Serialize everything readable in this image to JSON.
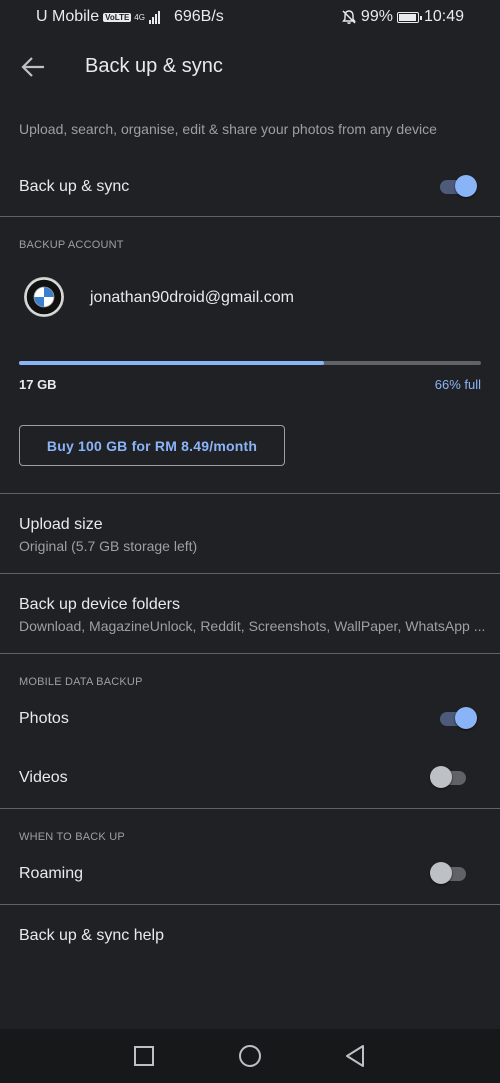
{
  "status_bar": {
    "carrier": "U Mobile",
    "volte": "VoLTE",
    "network": "4G",
    "speed": "696B/s",
    "battery": "99%",
    "time": "10:49"
  },
  "header": {
    "title": "Back up & sync"
  },
  "description": "Upload, search, organise, edit & share your photos from any device",
  "backup_sync": {
    "label": "Back up & sync",
    "enabled": true
  },
  "backup_account": {
    "section_title": "BACKUP ACCOUNT",
    "email": "jonathan90droid@gmail.com",
    "used": "17 GB",
    "percent_label": "66% full",
    "fill_fraction": 0.66,
    "buy_button": "Buy 100 GB for RM 8.49/month"
  },
  "upload_size": {
    "label": "Upload size",
    "value": "Original (5.7 GB storage left)"
  },
  "device_folders": {
    "label": "Back up device folders",
    "value": "Download, MagazineUnlock, Reddit, Screenshots, WallPaper, WhatsApp ..."
  },
  "mobile_data": {
    "section_title": "MOBILE DATA BACKUP",
    "photos": {
      "label": "Photos",
      "enabled": true
    },
    "videos": {
      "label": "Videos",
      "enabled": false
    }
  },
  "when_to_backup": {
    "section_title": "WHEN TO BACK UP",
    "roaming": {
      "label": "Roaming",
      "enabled": false
    }
  },
  "help": {
    "label": "Back up & sync help"
  },
  "colors": {
    "accent": "#8ab4f8",
    "background": "#202124"
  }
}
